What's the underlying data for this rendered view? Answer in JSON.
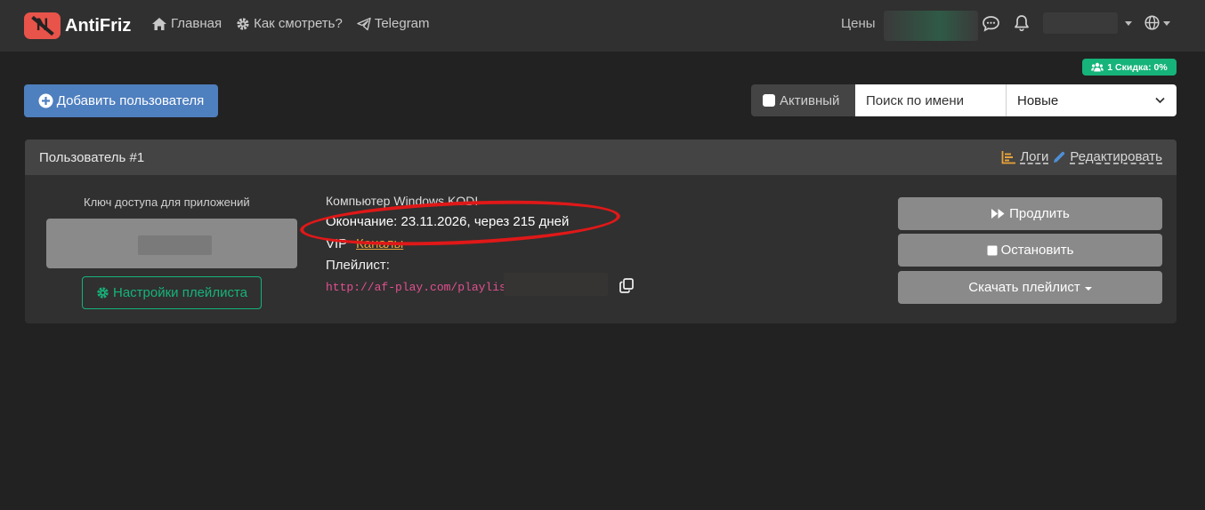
{
  "navbar": {
    "brand_text": "AntiFriz",
    "brand_logo_letter": "N",
    "links": [
      {
        "label": "Главная",
        "icon": "home-icon"
      },
      {
        "label": "Как смотреть?",
        "icon": "gear-icon"
      },
      {
        "label": "Telegram",
        "icon": "telegram-icon"
      }
    ],
    "prices_label": "Цены"
  },
  "badge": {
    "text": "1 Скидка: 0%",
    "icon": "users-icon",
    "color": "#16b37a"
  },
  "toolbar": {
    "add_user_label": "Добавить пользователя",
    "active_filter_label": "Активный",
    "search_placeholder": "Поиск по имени",
    "sort_selected": "Новые"
  },
  "user_card": {
    "title": "Пользователь #1",
    "logs_label": "Логи",
    "edit_label": "Редактировать",
    "access_key_label": "Ключ доступа для приложений",
    "playlist_settings_label": "Настройки плейлиста",
    "device": "Компьютер Windows KODI",
    "expiry": "Окончание: 23.11.2026, через 215 дней",
    "plan": "VIP",
    "channels_link": "Каналы",
    "playlist_label": "Плейлист:",
    "playlist_url": "http://af-play.com/playlis",
    "extend_label": "Продлить",
    "stop_label": "Остановить",
    "download_label": "Скачать плейлист"
  },
  "colors": {
    "accent_green": "#16b37a",
    "primary_blue": "#4e7fbf",
    "link_orange": "#e8a23a",
    "url_pink": "#e2508f",
    "annotation_red": "#e01818"
  }
}
